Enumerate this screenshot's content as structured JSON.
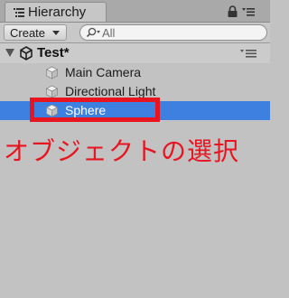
{
  "tab": {
    "title": "Hierarchy"
  },
  "toolbar": {
    "create_label": "Create",
    "search_placeholder": "All"
  },
  "scene": {
    "name": "Test*"
  },
  "objects": [
    {
      "name": "Main Camera",
      "selected": false
    },
    {
      "name": "Directional Light",
      "selected": false
    },
    {
      "name": "Sphere",
      "selected": true
    }
  ],
  "annotation": {
    "text": "オブジェクトの選択"
  },
  "colors": {
    "selection": "#3d80df",
    "annotation": "#e8141f",
    "panel_bg": "#c2c2c2"
  },
  "icons": {
    "tab": "hierarchy-list-icon",
    "lock": "lock-icon",
    "menu": "panel-menu-icon",
    "search": "search-icon",
    "scene": "unity-logo-icon",
    "object": "gameobject-cube-icon"
  }
}
